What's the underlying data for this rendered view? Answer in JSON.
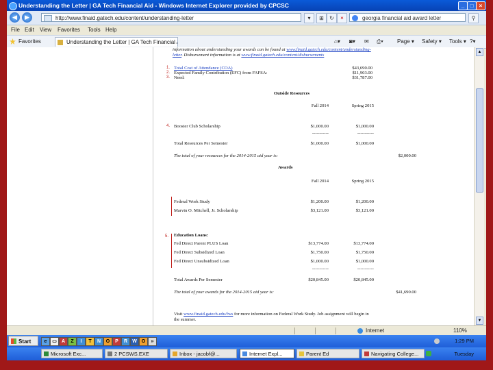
{
  "window": {
    "title": "Understanding the Letter | GA Tech Financial Aid - Windows Internet Explorer provided by CPCSC"
  },
  "address": {
    "url": "http://www.finaid.gatech.edu/content/understanding-letter",
    "search_text": "georgia financial aid award letter"
  },
  "menu": [
    "File",
    "Edit",
    "View",
    "Favorites",
    "Tools",
    "Help"
  ],
  "favorites": {
    "label": "Favorites",
    "tab_title": "Understanding the Letter | GA Tech Financial Aid",
    "tools": [
      "Page ▾",
      "Safety ▾",
      "Tools ▾"
    ]
  },
  "doc": {
    "intro_line1": "information about understanding your awards can be found at",
    "intro_link1": "www.finaid.gatech.edu/content/understanding-",
    "intro_link2": "letter",
    "intro_line2": ". Disbursement information is at",
    "intro_link3": "www.finaid.gatech.edu/content/disbursements",
    "markers": [
      "1.",
      "2.",
      "3.",
      "4.",
      "5."
    ],
    "coa_label": "Total Cost of Attendance (COA)",
    "coa_value": "$43,690.00",
    "efc_label": "Expected Family Contribution (EFC) from FAFSA:",
    "efc_value": "$11,903.00",
    "need_label": "Need:",
    "need_value": "$31,787.00",
    "outside_heading": "Outside Resources",
    "term1": "Fall 2014",
    "term2": "Spring 2015",
    "booster_label": "Booster Club Scholarship",
    "booster_fall": "$1,000.00",
    "booster_spring": "$1,000.00",
    "dashes": "-----------",
    "res_total_label": "Total Resources Per Semester",
    "res_total_fall": "$1,000.00",
    "res_total_spring": "$1,000.00",
    "res_year_text": "The total of your resources for the 2014-2015 aid year is:",
    "res_year_value": "$2,000.00",
    "awards_heading": "Awards",
    "fws_label": "Federal Work Study",
    "fws_fall": "$1,200.00",
    "fws_spring": "$1,200.00",
    "mm_label": "Marvin O. Mitchell, Jr. Scholarship",
    "mm_fall": "$3,121.00",
    "mm_spring": "$3,121.00",
    "loans_heading": "Education Loans:",
    "plus_label": "Fed Direct Parent PLUS Loan",
    "plus_fall": "$13,774.00",
    "plus_spring": "$13,774.00",
    "sub_label": "Fed Direct Subsidized Loan",
    "sub_fall": "$1,750.00",
    "sub_spring": "$1,750.00",
    "unsub_label": "Fed Direct Unsubsidized Loan",
    "unsub_fall": "$1,000.00",
    "unsub_spring": "$1,000.00",
    "awards_total_label": "Total Awards Per Semester",
    "awards_total_fall": "$20,845.00",
    "awards_total_spring": "$20,845.00",
    "awards_year_text": "The total of your awards for the 2014-2015 aid year is:",
    "awards_year_value": "$41,690.00",
    "visit_prefix": "Visit",
    "visit_link": "www.finaid.gatech.edu/fws",
    "visit_rest": "for more information on Federal Work Study. Job assignment will begin in",
    "visit_line2": "the summer."
  },
  "status": {
    "zone": "Internet",
    "zoom": "110%"
  },
  "taskbar": {
    "start_label": "Start",
    "quicklaunch": [
      "A",
      "Z",
      "I",
      "T",
      "N",
      "O",
      "P",
      "R",
      "W",
      "O"
    ],
    "buttons": [
      "Microsoft Exc...",
      "2 PCSWS.EXE",
      "Inbox - jacobf@...",
      "Internet Expl...",
      "Parent Ed",
      "Navigating College..."
    ],
    "time": "1:29 PM",
    "day": "Tuesday"
  },
  "colors": {
    "accent_red": "#c0211c",
    "link_blue": "#1a3fc2",
    "titlebar_blue": "#0a5ad8"
  }
}
